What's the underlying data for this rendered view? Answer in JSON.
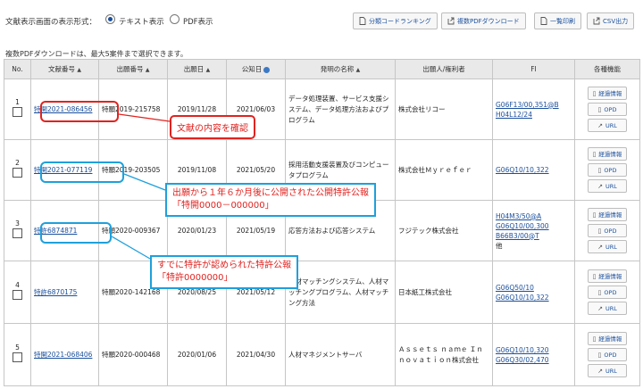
{
  "display_mode": {
    "label": "文献表示画面の表示形式：",
    "options": [
      {
        "label": "テキスト表示",
        "selected": true
      },
      {
        "label": "PDF表示",
        "selected": false
      }
    ]
  },
  "toolbar": {
    "buttons": [
      "分類コードランキング",
      "複数PDFダウンロード",
      "一覧印刷",
      "CSV出力"
    ]
  },
  "note": "複数PDFダウンロードは、最大5案件まで選択できます。",
  "table": {
    "headers": {
      "no": "No.",
      "doc_no": "文献番号",
      "app_no": "出願番号",
      "app_date": "出願日",
      "pub_date": "公知日",
      "title": "発明の名称",
      "applicant": "出願人/権利者",
      "fi": "FI",
      "actions": "各種機能"
    },
    "rows": [
      {
        "no": "1",
        "doc_no": "特開2021-086456",
        "app_no": "特願2019-215758",
        "app_date": "2019/11/28",
        "pub_date": "2021/06/03",
        "title": "データ処理装置、サービス支援システム、データ処理方法およびプログラム",
        "applicant": "株式会社リコー",
        "fi": [
          "G06F13/00,351@B",
          "H04L12/24"
        ]
      },
      {
        "no": "2",
        "doc_no": "特開2021-077119",
        "app_no": "特願2019-203505",
        "app_date": "2019/11/08",
        "pub_date": "2021/05/20",
        "title": "採用活動支援装置及びコンピュータプログラム",
        "applicant": "株式会社Ｍｙｒｅｆｅｒ",
        "fi": [
          "G06Q10/10,322"
        ]
      },
      {
        "no": "3",
        "doc_no": "特許6874871",
        "app_no": "特願2020-009367",
        "app_date": "2020/01/23",
        "pub_date": "2021/05/19",
        "title": "応答方法および応答システム",
        "applicant": "フジテック株式会社",
        "fi": [
          "H04M3/50@A",
          "G06Q10/00,300",
          "B66B3/00@T"
        ],
        "fi_extra": "他"
      },
      {
        "no": "4",
        "doc_no": "特許6870175",
        "app_no": "特願2020-142168",
        "app_date": "2020/08/25",
        "pub_date": "2021/05/12",
        "title": "人材マッチングシステム、人材マッチングプログラム、人材マッチング方法",
        "applicant": "日本紙工株式会社",
        "fi": [
          "G06Q50/10",
          "G06Q10/10,322"
        ]
      },
      {
        "no": "5",
        "doc_no": "特開2021-068406",
        "app_no": "特願2020-000468",
        "app_date": "2020/01/06",
        "pub_date": "2021/04/30",
        "title": "人材マネジメントサーバ",
        "applicant": "Ａｓｓｅｔｓ ｎａｍｅ Ｉｎｎｏｖａｔｉｏｎ株式会社",
        "fi": [
          "G06Q10/10,320",
          "G06Q30/02,470"
        ]
      }
    ],
    "action_labels": [
      "経過情報",
      "OPD",
      "URL"
    ]
  },
  "annotations": {
    "red": "文献の内容を確認",
    "blue1": [
      "出願から１年６か月後に公開された公開特許公報",
      "「特開0000－000000」"
    ],
    "blue2": [
      "すでに特許が認められた特許公報",
      "「特許0000000」"
    ]
  },
  "colors": {
    "link": "#1a4f9c",
    "annot_red": "#e0231f",
    "annot_blue": "#1ea0dc",
    "header_bg": "#e9e9e9"
  }
}
